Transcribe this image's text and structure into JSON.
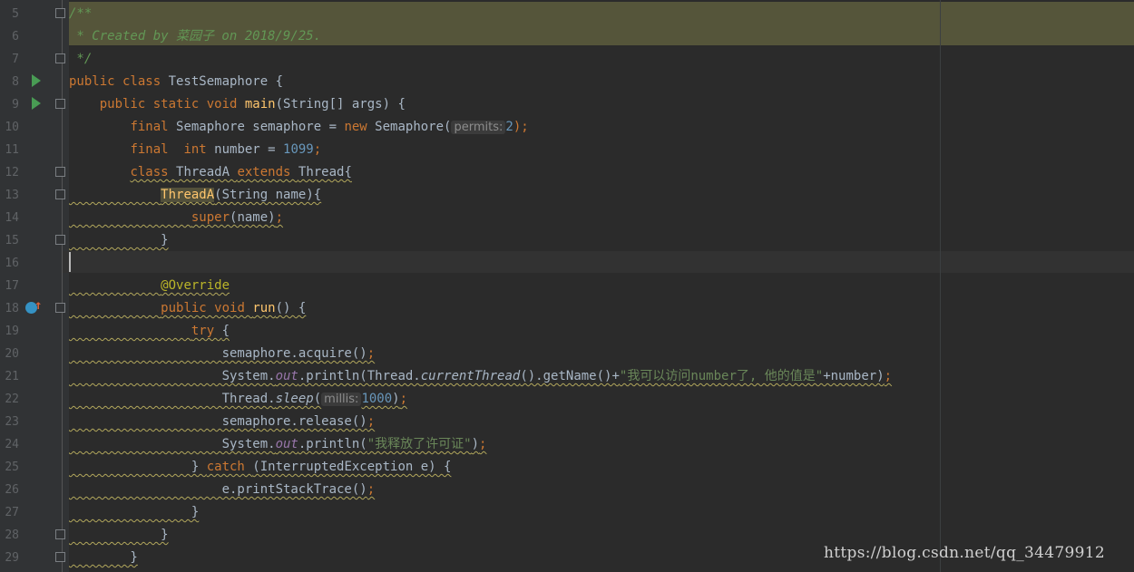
{
  "editor": {
    "lines": [
      {
        "number": "5",
        "tokens": [
          {
            "t": "/**",
            "c": "c"
          }
        ]
      },
      {
        "number": "6",
        "tokens": [
          {
            "t": " * Created by 菜园子 on 2018/9/25.",
            "c": "c"
          }
        ]
      },
      {
        "number": "7",
        "tokens": [
          {
            "t": " */",
            "c": "c"
          }
        ]
      },
      {
        "number": "8",
        "tokens": [
          {
            "t": "public class ",
            "c": "k"
          },
          {
            "t": "TestSemaphore {",
            "c": ""
          }
        ]
      },
      {
        "number": "9",
        "tokens": [
          {
            "t": "    "
          },
          {
            "t": "public static void ",
            "c": "k"
          },
          {
            "t": "main",
            "c": "f"
          },
          {
            "t": "(String[] args) {"
          }
        ]
      },
      {
        "number": "10",
        "tokens": [
          {
            "t": "        "
          },
          {
            "t": "final ",
            "c": "k"
          },
          {
            "t": "Semaphore semaphore = "
          },
          {
            "t": "new ",
            "c": "k"
          },
          {
            "t": "Semaphore("
          },
          {
            "t": "permits:",
            "c": "hint"
          },
          {
            "t": "2",
            "c": "n"
          },
          {
            "t": ");",
            "c": "k"
          }
        ]
      },
      {
        "number": "11",
        "tokens": [
          {
            "t": "        "
          },
          {
            "t": "final  int ",
            "c": "k"
          },
          {
            "t": "number = "
          },
          {
            "t": "1099",
            "c": "n"
          },
          {
            "t": ";",
            "c": "k"
          }
        ]
      },
      {
        "number": "12",
        "tokens": [
          {
            "t": "        "
          },
          {
            "t": "class ",
            "c": "k wav"
          },
          {
            "t": "ThreadA ",
            "c": "wav"
          },
          {
            "t": "extends ",
            "c": "k wav"
          },
          {
            "t": "Thread{",
            "c": "wav"
          }
        ]
      },
      {
        "number": "13",
        "tokens": [
          {
            "t": "            ",
            "c": "wav"
          },
          {
            "t": "ThreadA",
            "c": "f hlname wav"
          },
          {
            "t": "(String name){",
            "c": "wav"
          }
        ]
      },
      {
        "number": "14",
        "tokens": [
          {
            "t": "                ",
            "c": "wav"
          },
          {
            "t": "super",
            "c": "k wav"
          },
          {
            "t": "(name)",
            "c": "wav"
          },
          {
            "t": ";",
            "c": "k wav"
          }
        ]
      },
      {
        "number": "15",
        "tokens": [
          {
            "t": "            }",
            "c": "wav"
          }
        ]
      },
      {
        "number": "16",
        "tokens": []
      },
      {
        "number": "17",
        "tokens": [
          {
            "t": "            ",
            "c": "wav"
          },
          {
            "t": "@Override",
            "c": "ann wav"
          }
        ]
      },
      {
        "number": "18",
        "tokens": [
          {
            "t": "            ",
            "c": "wav"
          },
          {
            "t": "public void ",
            "c": "k wav"
          },
          {
            "t": "run",
            "c": "f wav"
          },
          {
            "t": "() {",
            "c": "wav"
          }
        ]
      },
      {
        "number": "19",
        "tokens": [
          {
            "t": "                ",
            "c": "wav"
          },
          {
            "t": "try ",
            "c": "k wav"
          },
          {
            "t": "{",
            "c": "wav"
          }
        ]
      },
      {
        "number": "20",
        "tokens": [
          {
            "t": "                    semaphore.acquire()",
            "c": "wav"
          },
          {
            "t": ";",
            "c": "k wav"
          }
        ]
      },
      {
        "number": "21",
        "tokens": [
          {
            "t": "                    System.",
            "c": "wav"
          },
          {
            "t": "out",
            "c": "st wav"
          },
          {
            "t": ".println(Thread.",
            "c": "wav"
          },
          {
            "t": "currentThread",
            "c": "it wav"
          },
          {
            "t": "().getName()+",
            "c": "wav"
          },
          {
            "t": "\"我可以访问number了, 他的值是\"",
            "c": "s wav"
          },
          {
            "t": "+number)",
            "c": "wav"
          },
          {
            "t": ";",
            "c": "k wav"
          }
        ]
      },
      {
        "number": "22",
        "tokens": [
          {
            "t": "                    Thread.",
            "c": "wav"
          },
          {
            "t": "sleep",
            "c": "it wav"
          },
          {
            "t": "(",
            "c": "wav"
          },
          {
            "t": "millis:",
            "c": "hint"
          },
          {
            "t": "1000",
            "c": "n wav"
          },
          {
            "t": ")",
            "c": "wav"
          },
          {
            "t": ";",
            "c": "k wav"
          }
        ]
      },
      {
        "number": "23",
        "tokens": [
          {
            "t": "                    semaphore.release()",
            "c": "wav"
          },
          {
            "t": ";",
            "c": "k wav"
          }
        ]
      },
      {
        "number": "24",
        "tokens": [
          {
            "t": "                    System.",
            "c": "wav"
          },
          {
            "t": "out",
            "c": "st wav"
          },
          {
            "t": ".println(",
            "c": "wav"
          },
          {
            "t": "\"我释放了许可证\"",
            "c": "s wav"
          },
          {
            "t": ")",
            "c": "wav"
          },
          {
            "t": ";",
            "c": "k wav"
          }
        ]
      },
      {
        "number": "25",
        "tokens": [
          {
            "t": "                } ",
            "c": "wav"
          },
          {
            "t": "catch ",
            "c": "k wav"
          },
          {
            "t": "(InterruptedException e) {",
            "c": "wav"
          }
        ]
      },
      {
        "number": "26",
        "tokens": [
          {
            "t": "                    e.printStackTrace()",
            "c": "wav"
          },
          {
            "t": ";",
            "c": "k wav"
          }
        ]
      },
      {
        "number": "27",
        "tokens": [
          {
            "t": "                }",
            "c": "wav"
          }
        ]
      },
      {
        "number": "28",
        "tokens": [
          {
            "t": "            }",
            "c": "wav"
          }
        ]
      },
      {
        "number": "29",
        "tokens": [
          {
            "t": "        }",
            "c": "wav"
          }
        ]
      }
    ]
  },
  "gutter_icons": {
    "run_lines": [
      "8",
      "9"
    ],
    "override_line": "18",
    "fold_lines": [
      "5",
      "7",
      "9",
      "12",
      "13",
      "15",
      "18",
      "28",
      "29"
    ]
  },
  "watermark": "https://blog.csdn.net/qq_34479912",
  "colors": {
    "background": "#2b2b2b",
    "gutter": "#313335",
    "keyword": "#cc7832",
    "function": "#ffc66d",
    "number": "#6897bb",
    "string": "#6a8759",
    "comment": "#629755",
    "annotation": "#bbb529",
    "static_field": "#9876aa"
  }
}
